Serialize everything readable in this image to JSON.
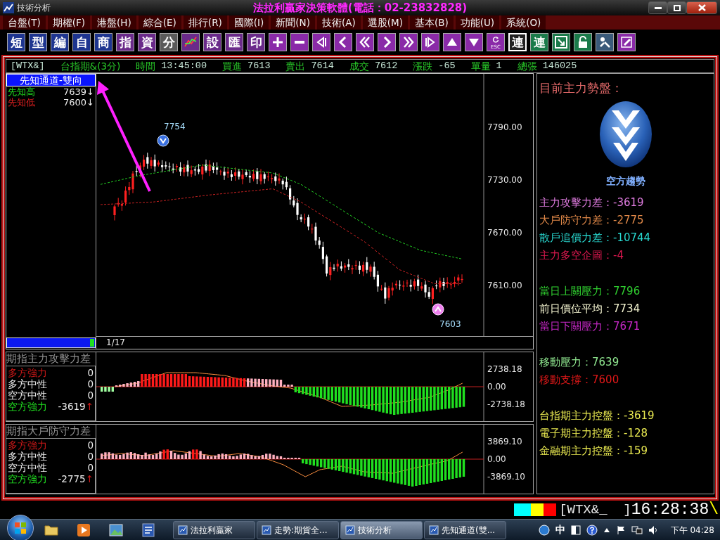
{
  "window": {
    "title": "技術分析",
    "app_title": "法拉利贏家決策軟體(電話：02-23832828)"
  },
  "menu": [
    {
      "label": "台盤(T)"
    },
    {
      "label": "期權(F)"
    },
    {
      "label": "港盤(H)"
    },
    {
      "label": "綜合(E)"
    },
    {
      "label": "排行(R)"
    },
    {
      "label": "國際(I)"
    },
    {
      "label": "新聞(N)"
    },
    {
      "label": "技術(A)"
    },
    {
      "label": "選股(M)"
    },
    {
      "label": "基本(B)"
    },
    {
      "label": "功能(U)"
    },
    {
      "label": "系統(O)"
    }
  ],
  "toolbar": [
    {
      "kind": "text",
      "label": "短",
      "color": "#1e3590",
      "selected": false
    },
    {
      "kind": "text",
      "label": "型",
      "color": "#1e3590",
      "selected": false
    },
    {
      "kind": "text",
      "label": "編",
      "color": "#1e3590",
      "selected": false
    },
    {
      "kind": "text",
      "label": "自",
      "color": "#1e3590",
      "selected": false
    },
    {
      "kind": "text",
      "label": "商",
      "color": "#1e3590",
      "selected": false
    },
    {
      "kind": "text",
      "label": "指",
      "color": "#6a2a8a",
      "selected": false
    },
    {
      "kind": "text",
      "label": "資",
      "color": "#6a2a8a",
      "selected": false
    },
    {
      "kind": "text",
      "label": "分",
      "color": "#5a5a5a",
      "selected": false
    },
    {
      "kind": "chart",
      "color": "#6a2a8a",
      "selected": false
    },
    {
      "kind": "text",
      "label": "設",
      "color": "#6a2a8a",
      "selected": false
    },
    {
      "kind": "text",
      "label": "匯",
      "color": "#6a2a8a",
      "selected": false
    },
    {
      "kind": "text",
      "label": "印",
      "color": "#6a2a8a",
      "selected": false
    },
    {
      "kind": "plus",
      "color": "#8a2aa8",
      "selected": false
    },
    {
      "kind": "minus",
      "color": "#8a2aa8",
      "selected": false
    },
    {
      "kind": "first",
      "color": "#8a2aa8",
      "selected": false
    },
    {
      "kind": "prev",
      "color": "#8a2aa8",
      "selected": false
    },
    {
      "kind": "rewind",
      "color": "#8a2aa8",
      "selected": false
    },
    {
      "kind": "next",
      "color": "#8a2aa8",
      "selected": false
    },
    {
      "kind": "forward",
      "color": "#8a2aa8",
      "selected": false
    },
    {
      "kind": "last",
      "color": "#8a2aa8",
      "selected": false
    },
    {
      "kind": "up",
      "color": "#8a2aa8",
      "selected": false
    },
    {
      "kind": "down",
      "color": "#8a2aa8",
      "selected": false
    },
    {
      "kind": "esc",
      "label": "ESC",
      "color": "#8a2aa8",
      "selected": false
    },
    {
      "kind": "text",
      "label": "連",
      "color": "#202020",
      "selected": true
    },
    {
      "kind": "text",
      "label": "連",
      "color": "#1a7a4a",
      "selected": false
    },
    {
      "kind": "window",
      "color": "#1a7a4a",
      "selected": false
    },
    {
      "kind": "lock",
      "color": "#1a7a4a",
      "selected": false
    },
    {
      "kind": "tools",
      "color": "#3a5a7a",
      "selected": false
    },
    {
      "kind": "edit",
      "color": "#8a2aa8",
      "selected": false
    }
  ],
  "quote": {
    "code": "[WTX&]",
    "name": "台指期&(3分)",
    "fields": [
      {
        "label": "時間",
        "value": "13:45:00"
      },
      {
        "label": "買進",
        "value": "7613"
      },
      {
        "label": "賣出",
        "value": "7614"
      },
      {
        "label": "成交",
        "value": "7612"
      },
      {
        "label": "漲跌",
        "value": "-65"
      },
      {
        "label": "單量",
        "value": "1"
      },
      {
        "label": "總張",
        "value": "146025"
      }
    ]
  },
  "main_chart": {
    "legend_title": "先知通道-雙向",
    "legend": [
      {
        "label": "先知高",
        "value": "7639",
        "arrow": "↓",
        "color": "#20e020"
      },
      {
        "label": "先知低",
        "value": "7600",
        "arrow": "↓",
        "color": "#e02020"
      }
    ],
    "y_labels": [
      "7790.00",
      "7730.00",
      "7670.00",
      "7610.00"
    ],
    "high_marker": "7754",
    "low_marker": "7603",
    "page": "1/17"
  },
  "indicators": [
    {
      "title": "期指主力攻擊力差",
      "rows": [
        {
          "label": "多方強力",
          "value": "0",
          "color": "#d01818"
        },
        {
          "label": "多方中性",
          "value": "0",
          "color": "#f0f0f0"
        },
        {
          "label": "空方中性",
          "value": "0",
          "color": "#f0f0f0"
        },
        {
          "label": "空方強力",
          "value": "-3619",
          "color": "#20e020",
          "arrow": "↑"
        }
      ],
      "y_labels": [
        "2738.18",
        "0.00",
        "-2738.18"
      ]
    },
    {
      "title": "期指大戶防守力差",
      "rows": [
        {
          "label": "多方強力",
          "value": "0",
          "color": "#d01818"
        },
        {
          "label": "多方中性",
          "value": "0",
          "color": "#f0f0f0"
        },
        {
          "label": "空方中性",
          "value": "0",
          "color": "#f0f0f0"
        },
        {
          "label": "空方強力",
          "value": "-2775",
          "color": "#20e020",
          "arrow": "↑"
        }
      ],
      "y_labels": [
        "3869.10",
        "0.00",
        "-3869.10"
      ]
    }
  ],
  "side_panel": {
    "heading": "目前主力勢盤：",
    "trend": "空方趨勢",
    "groups": [
      [
        {
          "text": "主力攻擊力差：-3619",
          "color": "#e07ce0"
        },
        {
          "text": "大戶防守力差：-2775",
          "color": "#e08848"
        },
        {
          "text": "散戶追價力差：-10744",
          "color": "#28d8d0"
        },
        {
          "text": "主力多空企圖：-4",
          "color": "#e01850"
        }
      ],
      [
        {
          "text": "當日上關壓力：7796",
          "color": "#30d030"
        },
        {
          "text": "前日價位平均：7734",
          "color": "#f4f4d0"
        },
        {
          "text": "當日下關壓力：7671",
          "color": "#c828c8"
        }
      ],
      [
        {
          "text": "移動壓力：7639",
          "color": "#90e890"
        },
        {
          "text": "移動支撐：7600",
          "color": "#e01818"
        }
      ],
      [
        {
          "text": "台指期主力控盤：-3619",
          "color": "#e8e850"
        },
        {
          "text": "電子期主力控盤：-128",
          "color": "#e8e850"
        },
        {
          "text": "金融期主力控盤：-159",
          "color": "#e8e850"
        }
      ]
    ]
  },
  "status": {
    "lights": [
      {
        "color": "#00ffff"
      },
      {
        "color": "#ffff00"
      },
      {
        "color": "#ff0000"
      }
    ],
    "code": "[WTX&_  ]",
    "clock": "16:28:38",
    "spinner": "\\"
  },
  "taskbar": {
    "tasks": [
      {
        "label": "法拉利贏家",
        "selected": false
      },
      {
        "label": "走勢:期貨全...",
        "selected": false
      },
      {
        "label": "技術分析",
        "selected": true
      },
      {
        "label": "先知通道(雙...",
        "selected": false
      }
    ],
    "ime": "中",
    "clock": "下午 04:28"
  }
}
